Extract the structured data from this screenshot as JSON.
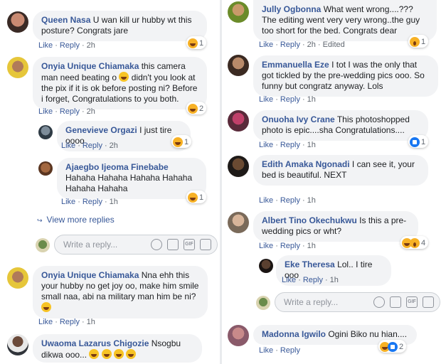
{
  "action_like": "Like",
  "action_reply": "Reply",
  "dot": "·",
  "reply_placeholder": "Write a reply...",
  "gif_label": "GIF",
  "view_more": "View more replies",
  "comments": {
    "c1": {
      "author": "Queen Nasa",
      "text": "U wan kill ur hubby wt this posture? Congrats jare",
      "time": "2h",
      "reaction_count": "1"
    },
    "c2": {
      "author": "Onyia Unique Chiamaka",
      "text_a": "this camera man need beating o",
      "text_b": "didn't you look at the pix if it is ok before posting ni? Before i forget, Congratulations to you both.",
      "time": "2h",
      "reaction_count": "2"
    },
    "c3": {
      "author": "Genevieve Orgazi",
      "text": "I just tire oooo",
      "time": "2h",
      "reaction_count": "1"
    },
    "c4": {
      "author": "Ajaegbo Ijeoma Finebabe",
      "text": "Hahaha Hahaha Hahaha Hahaha Hahaha Hahaha",
      "time": "1h",
      "reaction_count": "1"
    },
    "c5": {
      "author": "Onyia Unique Chiamaka",
      "text": "Nna ehh this your hubby no get joy oo, make him smile small naa, abi na military man him be ni?",
      "time": "1h"
    },
    "c6": {
      "author": "Uwaoma Lazarus Chigozie",
      "text": "Nsogbu dikwa ooo..."
    },
    "r1": {
      "author": "Jully Ogbonna",
      "text": "What went wrong....??? The editing went very very wrong..the guy too short for the bed. Congrats dear",
      "time": "2h",
      "edited": "Edited",
      "reaction_count": "1"
    },
    "r2": {
      "author": "Emmanuella Eze",
      "text": "I tot I was the only that got tickled by the pre-wedding pics ooo. So funny but congratz anyway. Lols",
      "time": "1h"
    },
    "r3": {
      "author": "Onuoha Ivy Crane",
      "text": "This photoshopped photo is epic....sha Congratulations....",
      "time": "1h",
      "reaction_count": "1"
    },
    "r4": {
      "author": "Edith Amaka Ngonadi",
      "text": "I can see it, your bed is beautiful. NEXT",
      "time": "1h"
    },
    "r5": {
      "author": "Albert Tino Okechukwu",
      "text": "Is this a pre-wedding pics or wht?",
      "time": "1h",
      "reaction_count": "4"
    },
    "r6": {
      "author": "Eke Theresa",
      "text": "Lol.. I tire ooo",
      "time": "1h"
    },
    "r7": {
      "author": "Madonna Igwilo",
      "text": "Ogini Biko nu hian....",
      "reaction_count": "2"
    }
  },
  "colors": {
    "link": "#385898",
    "bubble": "#f2f3f5",
    "meta": "#606770",
    "haha": "#f7b125",
    "like": "#1877f2"
  }
}
